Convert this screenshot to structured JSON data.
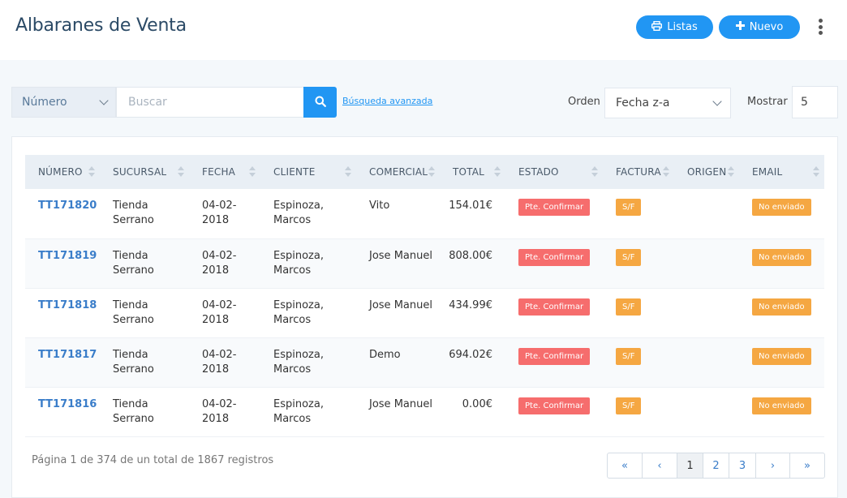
{
  "header": {
    "title": "Albaranes de Venta",
    "listas_label": "Listas",
    "nuevo_label": "Nuevo",
    "accent_color": "#2196f3"
  },
  "filters": {
    "field_select_value": "Número",
    "search_placeholder": "Buscar",
    "advanced_search_label": "Búsqueda avanzada",
    "orden_label": "Orden",
    "orden_value": "Fecha z-a",
    "mostrar_label": "Mostrar",
    "mostrar_value": "5"
  },
  "table": {
    "columns": [
      "NÚMERO",
      "SUCURSAL",
      "FECHA",
      "CLIENTE",
      "COMERCIAL",
      "TOTAL",
      "ESTADO",
      "FACTURA",
      "ORIGEN",
      "EMAIL"
    ],
    "rows": [
      {
        "numero": "TT171820",
        "sucursal": "Tienda Serrano",
        "fecha": "04-02-2018",
        "cliente": "Espinoza, Marcos",
        "comercial": "Vito",
        "total": "154.01€",
        "estado": "Pte. Confirmar",
        "factura": "S/F",
        "origen": "",
        "email": "No enviado"
      },
      {
        "numero": "TT171819",
        "sucursal": "Tienda Serrano",
        "fecha": "04-02-2018",
        "cliente": "Espinoza, Marcos",
        "comercial": "Jose Manuel",
        "total": "808.00€",
        "estado": "Pte. Confirmar",
        "factura": "S/F",
        "origen": "",
        "email": "No enviado"
      },
      {
        "numero": "TT171818",
        "sucursal": "Tienda Serrano",
        "fecha": "04-02-2018",
        "cliente": "Espinoza, Marcos",
        "comercial": "Jose Manuel",
        "total": "434.99€",
        "estado": "Pte. Confirmar",
        "factura": "S/F",
        "origen": "",
        "email": "No enviado"
      },
      {
        "numero": "TT171817",
        "sucursal": "Tienda Serrano",
        "fecha": "04-02-2018",
        "cliente": "Espinoza, Marcos",
        "comercial": "Demo",
        "total": "694.02€",
        "estado": "Pte. Confirmar",
        "factura": "S/F",
        "origen": "",
        "email": "No enviado"
      },
      {
        "numero": "TT171816",
        "sucursal": "Tienda Serrano",
        "fecha": "04-02-2018",
        "cliente": "Espinoza, Marcos",
        "comercial": "Jose Manuel",
        "total": "0.00€",
        "estado": "Pte. Confirmar",
        "factura": "S/F",
        "origen": "",
        "email": "No enviado"
      }
    ]
  },
  "footer": {
    "summary": "Página 1 de 374 de un total de 1867 registros",
    "pages": [
      "«",
      "‹",
      "1",
      "2",
      "3",
      "›",
      "»"
    ],
    "active_page": "1"
  },
  "colors": {
    "estado_badge": "#f66d6d",
    "factura_badge": "#f5a742",
    "email_badge": "#f5a742"
  }
}
